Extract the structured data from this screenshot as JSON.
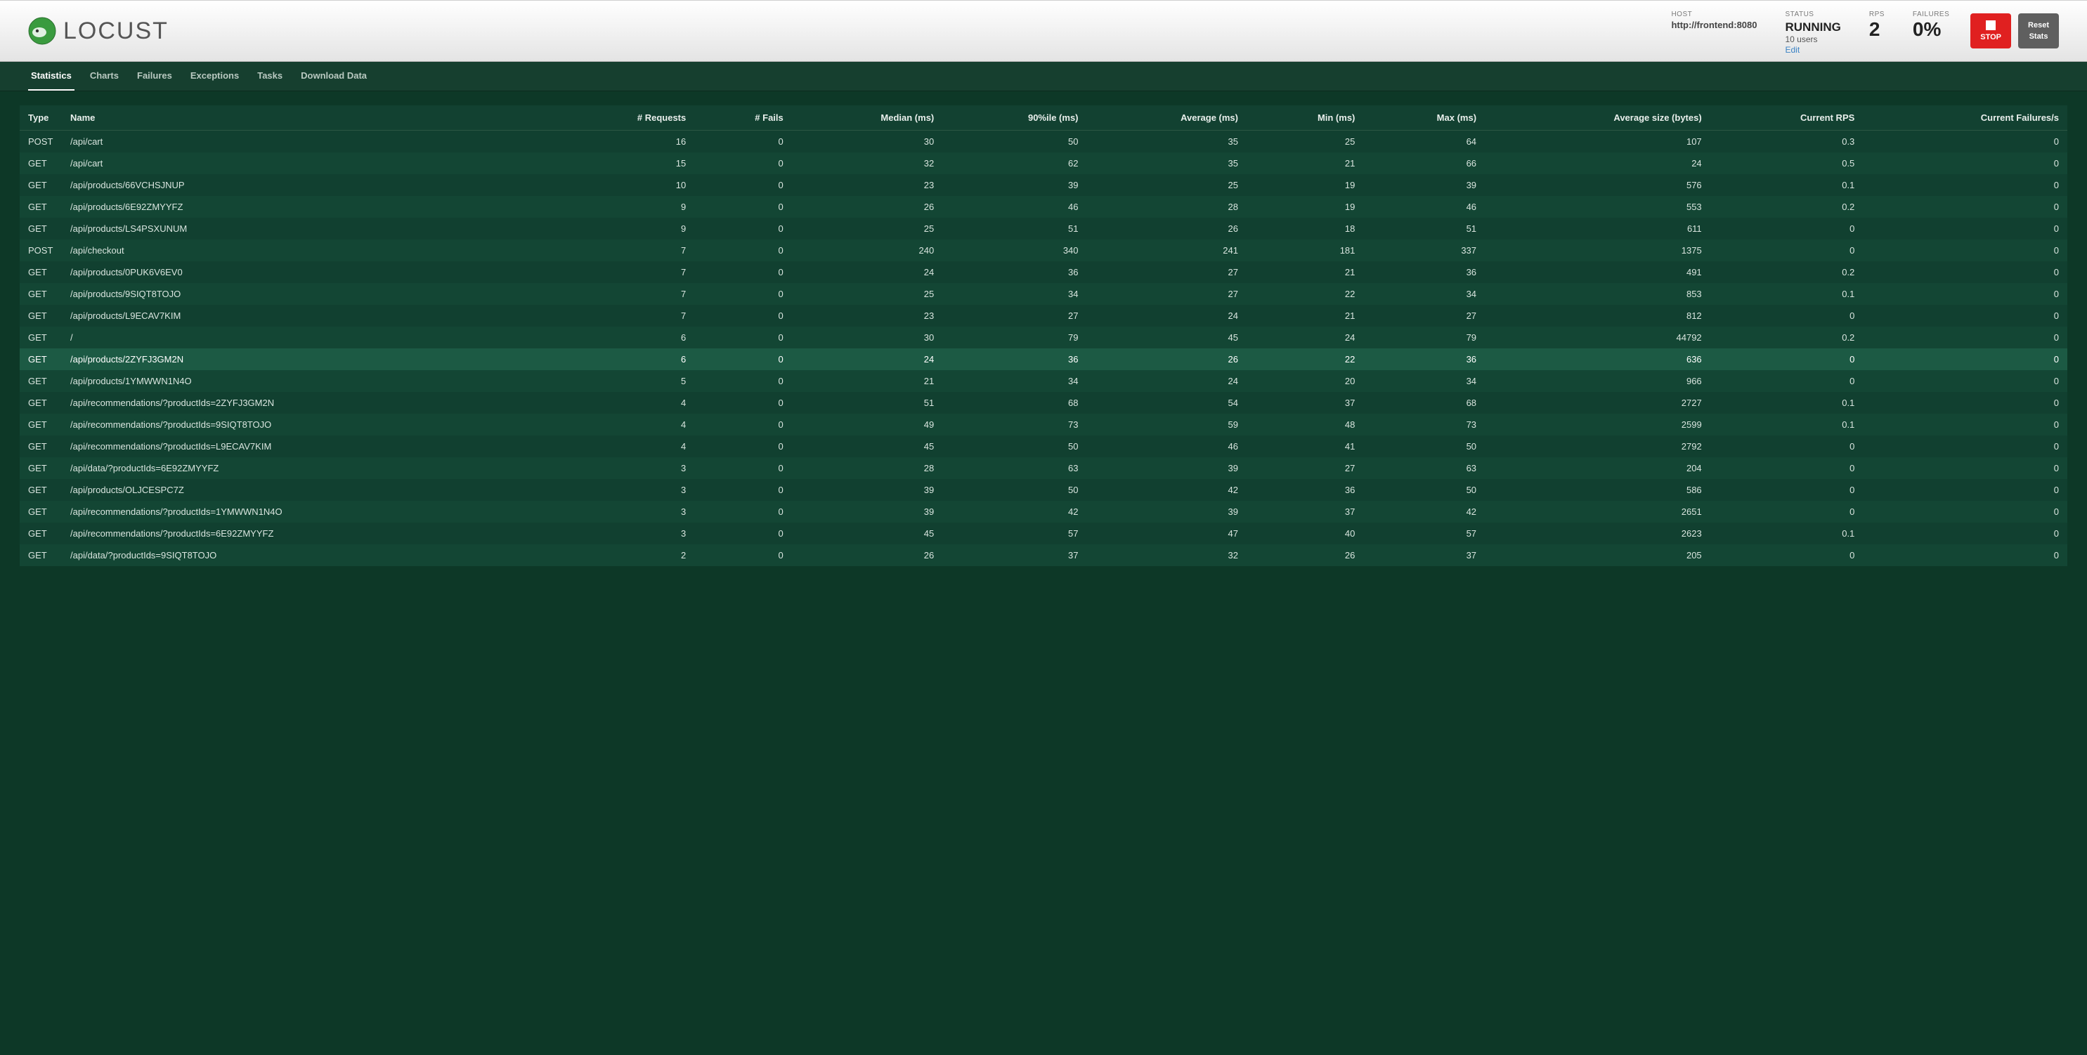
{
  "brand": "LOCUST",
  "header": {
    "host_label": "HOST",
    "host_value": "http://frontend:8080",
    "status_label": "STATUS",
    "status_value": "RUNNING",
    "status_sub": "10 users",
    "edit": "Edit",
    "rps_label": "RPS",
    "rps_value": "2",
    "failures_label": "FAILURES",
    "failures_value": "0%",
    "stop": "STOP",
    "reset1": "Reset",
    "reset2": "Stats"
  },
  "tabs": [
    "Statistics",
    "Charts",
    "Failures",
    "Exceptions",
    "Tasks",
    "Download Data"
  ],
  "active_tab": 0,
  "columns": [
    "Type",
    "Name",
    "# Requests",
    "# Fails",
    "Median (ms)",
    "90%ile (ms)",
    "Average (ms)",
    "Min (ms)",
    "Max (ms)",
    "Average size (bytes)",
    "Current RPS",
    "Current Failures/s"
  ],
  "highlight_row": 10,
  "rows": [
    {
      "type": "POST",
      "name": "/api/cart",
      "req": 16,
      "fails": 0,
      "median": 30,
      "p90": 50,
      "avg": 35,
      "min": 25,
      "max": 64,
      "size": 107,
      "rps": "0.3",
      "cfs": 0
    },
    {
      "type": "GET",
      "name": "/api/cart",
      "req": 15,
      "fails": 0,
      "median": 32,
      "p90": 62,
      "avg": 35,
      "min": 21,
      "max": 66,
      "size": 24,
      "rps": "0.5",
      "cfs": 0
    },
    {
      "type": "GET",
      "name": "/api/products/66VCHSJNUP",
      "req": 10,
      "fails": 0,
      "median": 23,
      "p90": 39,
      "avg": 25,
      "min": 19,
      "max": 39,
      "size": 576,
      "rps": "0.1",
      "cfs": 0
    },
    {
      "type": "GET",
      "name": "/api/products/6E92ZMYYFZ",
      "req": 9,
      "fails": 0,
      "median": 26,
      "p90": 46,
      "avg": 28,
      "min": 19,
      "max": 46,
      "size": 553,
      "rps": "0.2",
      "cfs": 0
    },
    {
      "type": "GET",
      "name": "/api/products/LS4PSXUNUM",
      "req": 9,
      "fails": 0,
      "median": 25,
      "p90": 51,
      "avg": 26,
      "min": 18,
      "max": 51,
      "size": 611,
      "rps": "0",
      "cfs": 0
    },
    {
      "type": "POST",
      "name": "/api/checkout",
      "req": 7,
      "fails": 0,
      "median": 240,
      "p90": 340,
      "avg": 241,
      "min": 181,
      "max": 337,
      "size": 1375,
      "rps": "0",
      "cfs": 0
    },
    {
      "type": "GET",
      "name": "/api/products/0PUK6V6EV0",
      "req": 7,
      "fails": 0,
      "median": 24,
      "p90": 36,
      "avg": 27,
      "min": 21,
      "max": 36,
      "size": 491,
      "rps": "0.2",
      "cfs": 0
    },
    {
      "type": "GET",
      "name": "/api/products/9SIQT8TOJO",
      "req": 7,
      "fails": 0,
      "median": 25,
      "p90": 34,
      "avg": 27,
      "min": 22,
      "max": 34,
      "size": 853,
      "rps": "0.1",
      "cfs": 0
    },
    {
      "type": "GET",
      "name": "/api/products/L9ECAV7KIM",
      "req": 7,
      "fails": 0,
      "median": 23,
      "p90": 27,
      "avg": 24,
      "min": 21,
      "max": 27,
      "size": 812,
      "rps": "0",
      "cfs": 0
    },
    {
      "type": "GET",
      "name": "/",
      "req": 6,
      "fails": 0,
      "median": 30,
      "p90": 79,
      "avg": 45,
      "min": 24,
      "max": 79,
      "size": 44792,
      "rps": "0.2",
      "cfs": 0
    },
    {
      "type": "GET",
      "name": "/api/products/2ZYFJ3GM2N",
      "req": 6,
      "fails": 0,
      "median": 24,
      "p90": 36,
      "avg": 26,
      "min": 22,
      "max": 36,
      "size": 636,
      "rps": "0",
      "cfs": 0
    },
    {
      "type": "GET",
      "name": "/api/products/1YMWWN1N4O",
      "req": 5,
      "fails": 0,
      "median": 21,
      "p90": 34,
      "avg": 24,
      "min": 20,
      "max": 34,
      "size": 966,
      "rps": "0",
      "cfs": 0
    },
    {
      "type": "GET",
      "name": "/api/recommendations/?productIds=2ZYFJ3GM2N",
      "req": 4,
      "fails": 0,
      "median": 51,
      "p90": 68,
      "avg": 54,
      "min": 37,
      "max": 68,
      "size": 2727,
      "rps": "0.1",
      "cfs": 0
    },
    {
      "type": "GET",
      "name": "/api/recommendations/?productIds=9SIQT8TOJO",
      "req": 4,
      "fails": 0,
      "median": 49,
      "p90": 73,
      "avg": 59,
      "min": 48,
      "max": 73,
      "size": 2599,
      "rps": "0.1",
      "cfs": 0
    },
    {
      "type": "GET",
      "name": "/api/recommendations/?productIds=L9ECAV7KIM",
      "req": 4,
      "fails": 0,
      "median": 45,
      "p90": 50,
      "avg": 46,
      "min": 41,
      "max": 50,
      "size": 2792,
      "rps": "0",
      "cfs": 0
    },
    {
      "type": "GET",
      "name": "/api/data/?productIds=6E92ZMYYFZ",
      "req": 3,
      "fails": 0,
      "median": 28,
      "p90": 63,
      "avg": 39,
      "min": 27,
      "max": 63,
      "size": 204,
      "rps": "0",
      "cfs": 0
    },
    {
      "type": "GET",
      "name": "/api/products/OLJCESPC7Z",
      "req": 3,
      "fails": 0,
      "median": 39,
      "p90": 50,
      "avg": 42,
      "min": 36,
      "max": 50,
      "size": 586,
      "rps": "0",
      "cfs": 0
    },
    {
      "type": "GET",
      "name": "/api/recommendations/?productIds=1YMWWN1N4O",
      "req": 3,
      "fails": 0,
      "median": 39,
      "p90": 42,
      "avg": 39,
      "min": 37,
      "max": 42,
      "size": 2651,
      "rps": "0",
      "cfs": 0
    },
    {
      "type": "GET",
      "name": "/api/recommendations/?productIds=6E92ZMYYFZ",
      "req": 3,
      "fails": 0,
      "median": 45,
      "p90": 57,
      "avg": 47,
      "min": 40,
      "max": 57,
      "size": 2623,
      "rps": "0.1",
      "cfs": 0
    },
    {
      "type": "GET",
      "name": "/api/data/?productIds=9SIQT8TOJO",
      "req": 2,
      "fails": 0,
      "median": 26,
      "p90": 37,
      "avg": 32,
      "min": 26,
      "max": 37,
      "size": 205,
      "rps": "0",
      "cfs": 0
    }
  ]
}
